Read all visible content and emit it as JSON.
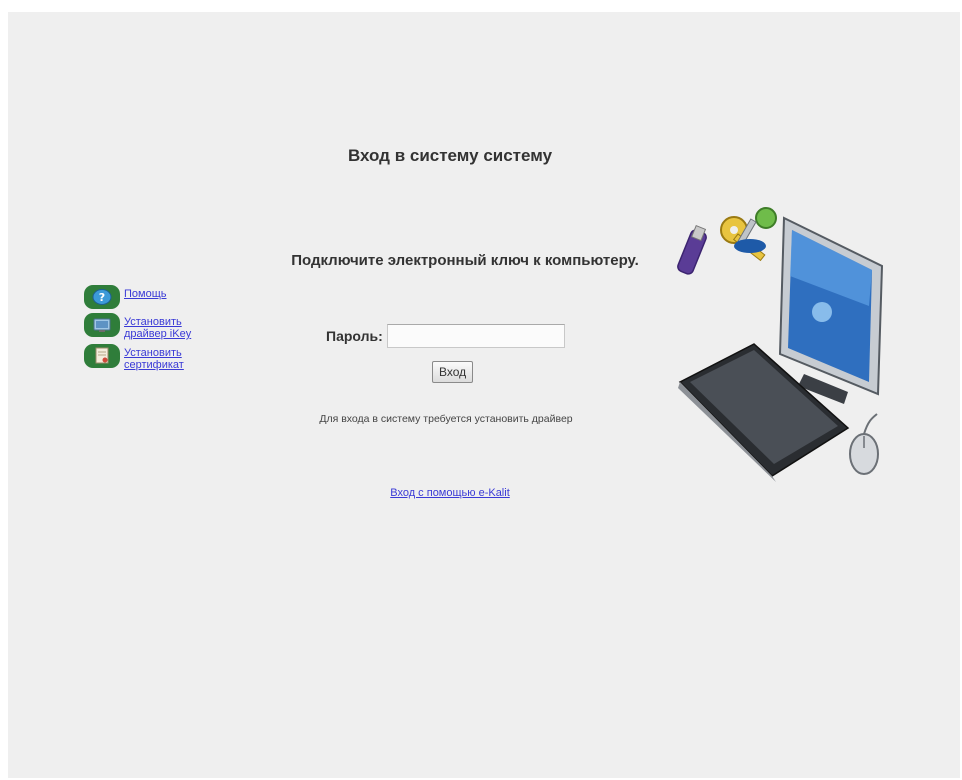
{
  "page": {
    "title": "Вход в систему систему",
    "subtitle": "Подключите электронный ключ к компьютеру."
  },
  "login": {
    "password_label": "Пароль:",
    "password_value": "",
    "submit_label": "Вход"
  },
  "note": "Для входа в систему требуется установить драйвер",
  "alt_login_link": "Вход с помощью e-Kalit",
  "sidebar": {
    "items": [
      {
        "label": "Помощь",
        "icon": "help-icon"
      },
      {
        "label": "Установить драйвер iKey",
        "icon": "driver-icon"
      },
      {
        "label": "Установить сертификат",
        "icon": "certificate-icon"
      }
    ]
  },
  "colors": {
    "background": "#efefef",
    "link": "#3a3ad6",
    "icon_green": "#2f7d3a",
    "text": "#333333"
  }
}
